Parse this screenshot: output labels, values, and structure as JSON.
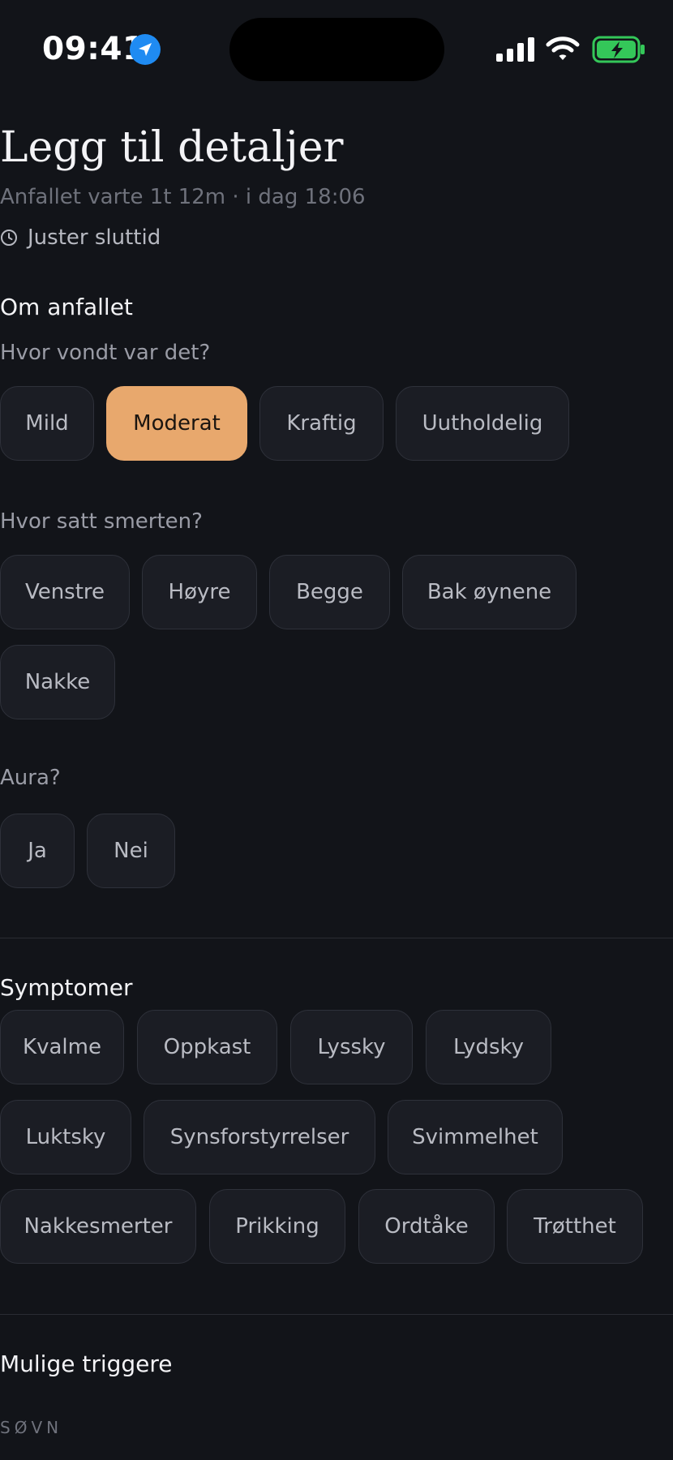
{
  "status_bar": {
    "time": "09:41",
    "icons": [
      "location-arrow-icon",
      "cellular-signal-icon",
      "wifi-icon",
      "battery-charging-icon"
    ]
  },
  "header": {
    "title": "Legg til detaljer",
    "subtitle": "Anfallet varte 1t 12m · i dag 18:06",
    "adjust_label": "Juster sluttid"
  },
  "about": {
    "title": "Om anfallet",
    "pain_question": "Hvor vondt var det?",
    "pain_options": [
      "Mild",
      "Moderat",
      "Kraftig",
      "Uutholdelig"
    ],
    "pain_selected": "Moderat",
    "location_question": "Hvor satt smerten?",
    "location_options": [
      "Venstre",
      "Høyre",
      "Begge",
      "Bak øynene",
      "Nakke"
    ],
    "aura_question": "Aura?",
    "aura_options": [
      "Ja",
      "Nei"
    ]
  },
  "symptoms": {
    "title": "Symptomer",
    "options": [
      "Kvalme",
      "Oppkast",
      "Lyssky",
      "Lydsky",
      "Luktsky",
      "Synsforstyrrelser",
      "Svimmelhet",
      "Nakkesmerter",
      "Prikking",
      "Ordtåke",
      "Trøtthet"
    ]
  },
  "triggers": {
    "title": "Mulige triggere",
    "sleep_label": "SØVN"
  },
  "colors": {
    "background": "#121419",
    "chip_background": "#1b1d24",
    "chip_border": "#2e313a",
    "selected_accent": "#e8a86d",
    "location_blue": "#1f8bf2",
    "battery_green": "#34c759"
  }
}
